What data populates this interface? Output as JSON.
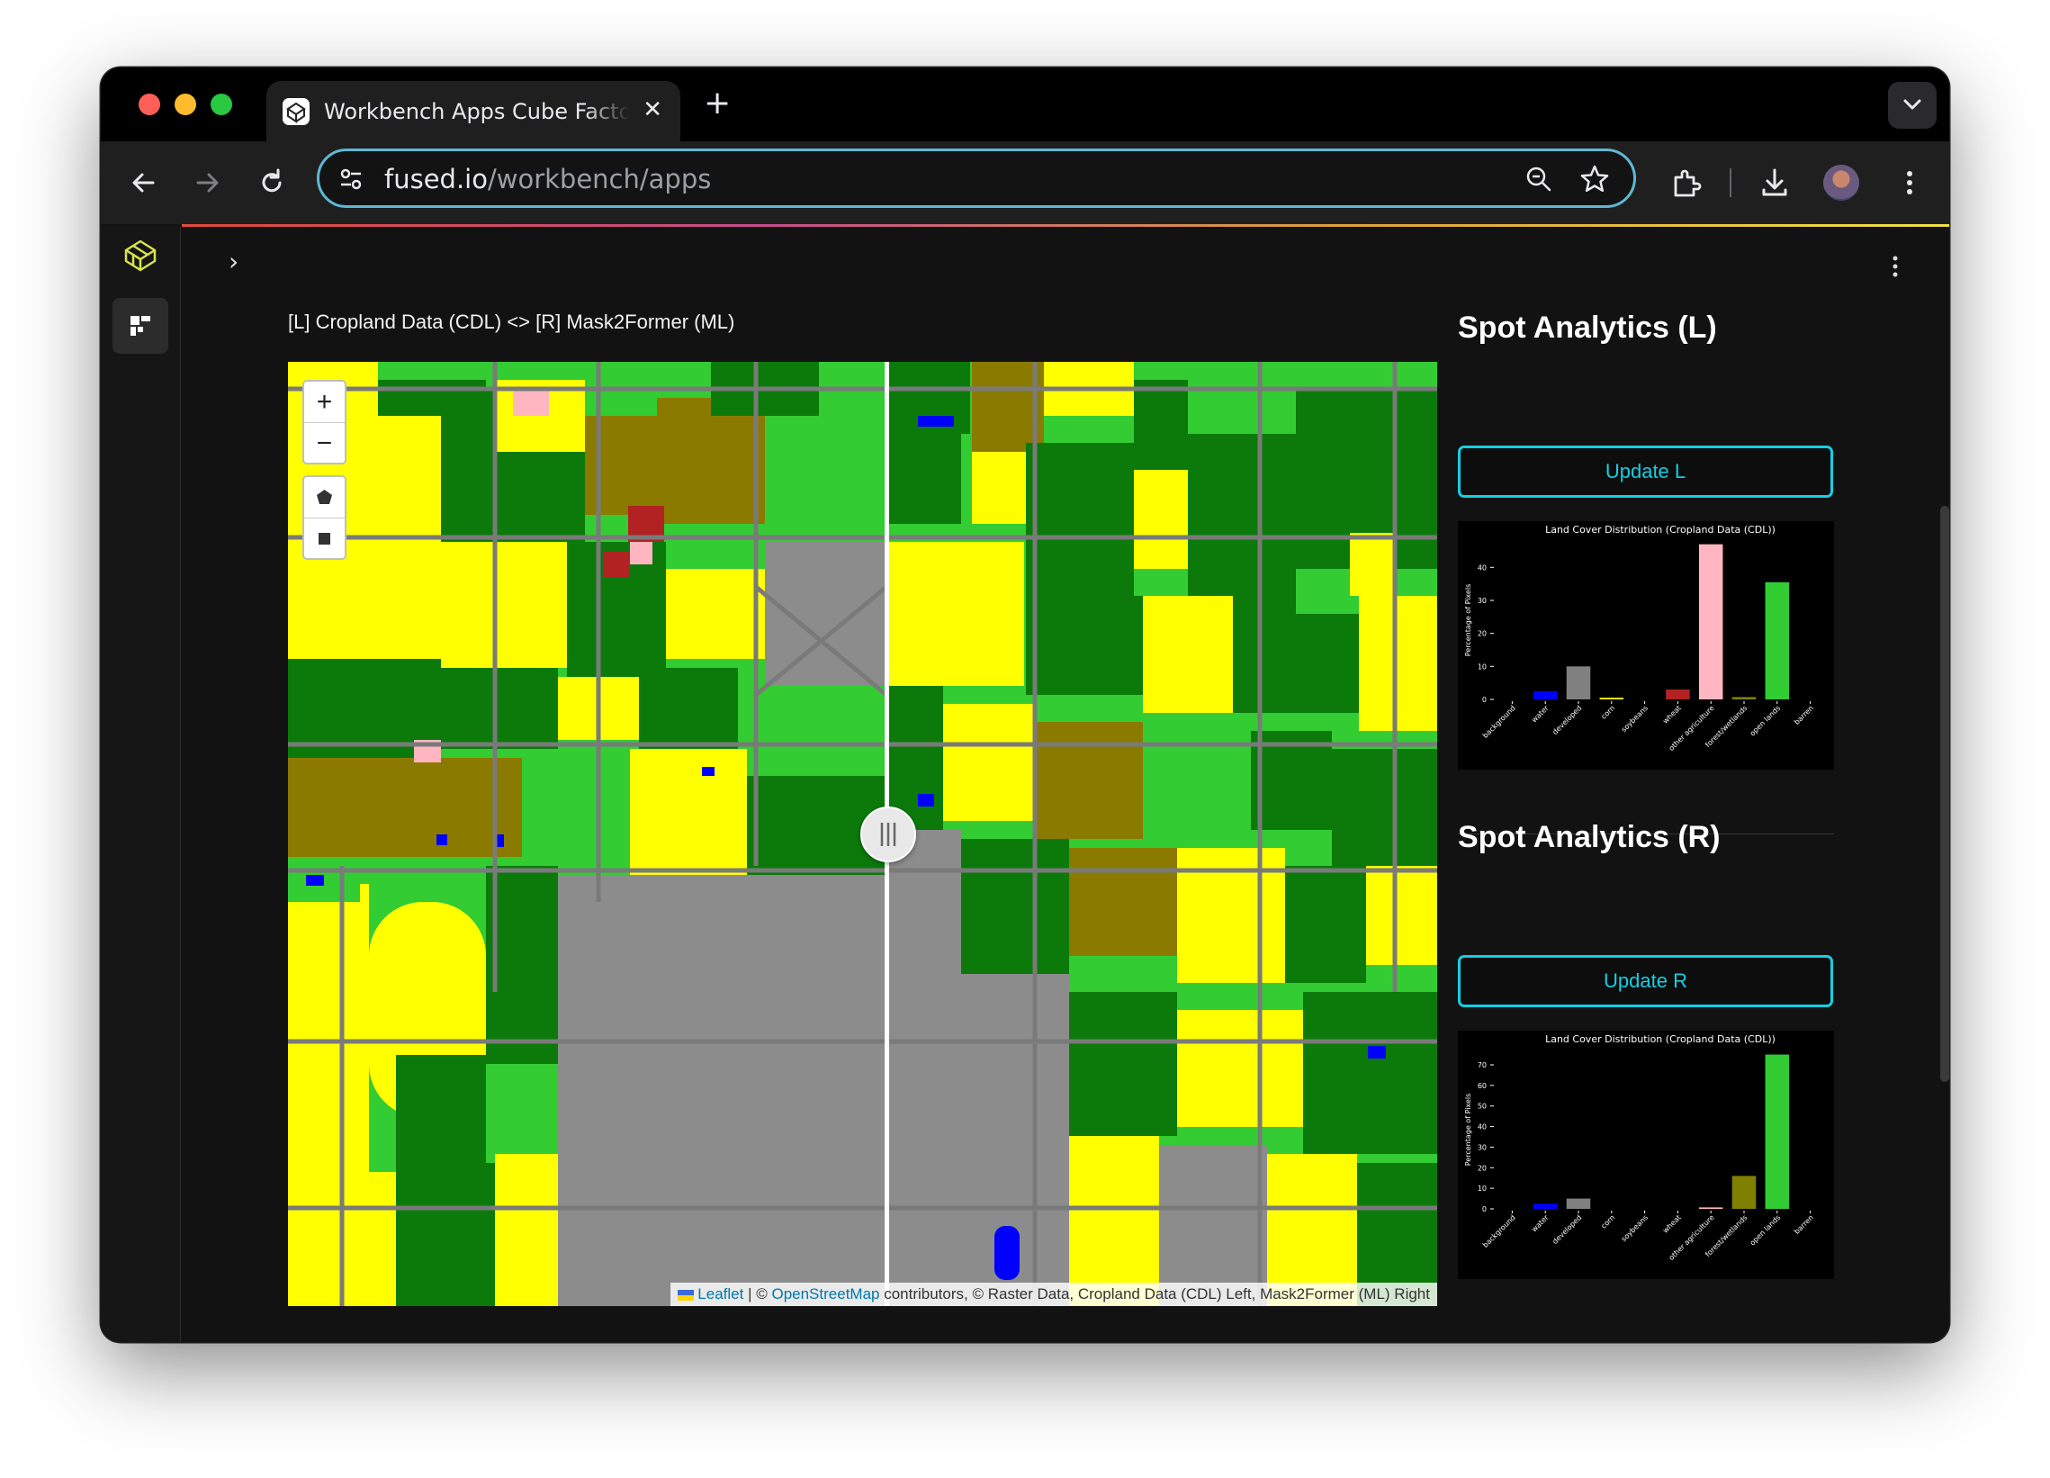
{
  "browser": {
    "tab_title": "Workbench Apps Cube Factory",
    "tab_close": "✕",
    "new_tab": "+",
    "url_host": "fused.io",
    "url_path": "/workbench/apps"
  },
  "app": {
    "expand_icon": "›",
    "map_title": "[L] Cropland Data (CDL) <> [R] Mask2Former (ML)",
    "zoom_in": "+",
    "zoom_out": "−",
    "attribution": {
      "leaflet": "Leaflet",
      "sep": " | © ",
      "osm": "OpenStreetMap",
      "rest": " contributors, © Raster Data, Cropland Data (CDL) Left, Mask2Former (ML) Right"
    },
    "left_panel": {
      "title": "Spot Analytics (L)",
      "button": "Update L"
    },
    "right_panel": {
      "title": "Spot Analytics (R)",
      "button": "Update R"
    }
  },
  "colors": {
    "yellow": "#ffff00",
    "darkgreen": "#0b7a0b",
    "lightgreen": "#33cc33",
    "olive": "#8b7a00",
    "gray": "#8c8c8c",
    "blue": "#0000ff",
    "red": "#b22222",
    "pink": "#ffb6c1",
    "accent": "#14cfe3"
  },
  "chart_data": [
    {
      "type": "bar",
      "title": "Land Cover Distribution (Cropland Data (CDL))",
      "ylabel": "Percentage of Pixels",
      "categories": [
        "background",
        "water",
        "developed",
        "corn",
        "soybeans",
        "wheat",
        "other agriculture",
        "forest/wetlands",
        "open lands",
        "barren"
      ],
      "values": [
        0,
        2.5,
        10,
        0.5,
        0,
        3,
        47,
        0.7,
        35.5,
        0
      ],
      "colors": [
        "#000000",
        "#0000ff",
        "#808080",
        "#ffff00",
        "#ffffff",
        "#b22222",
        "#ffb6c1",
        "#808000",
        "#32cd32",
        "#ffffff"
      ],
      "ylim": [
        0,
        48
      ],
      "yticks": [
        0,
        10,
        20,
        30,
        40
      ]
    },
    {
      "type": "bar",
      "title": "Land Cover Distribution (Cropland Data (CDL))",
      "ylabel": "Percentage of Pixels",
      "categories": [
        "background",
        "water",
        "developed",
        "corn",
        "soybeans",
        "wheat",
        "other agriculture",
        "forest/wetlands",
        "open lands",
        "barren"
      ],
      "values": [
        0,
        2.5,
        5,
        0,
        0,
        0,
        0.7,
        16,
        75,
        0
      ],
      "colors": [
        "#000000",
        "#0000ff",
        "#808080",
        "#ffff00",
        "#ffffff",
        "#b22222",
        "#ffb6c1",
        "#808000",
        "#32cd32",
        "#ffffff"
      ],
      "ylim": [
        0,
        77
      ],
      "yticks": [
        0,
        10,
        20,
        30,
        40,
        50,
        60,
        70
      ]
    }
  ]
}
